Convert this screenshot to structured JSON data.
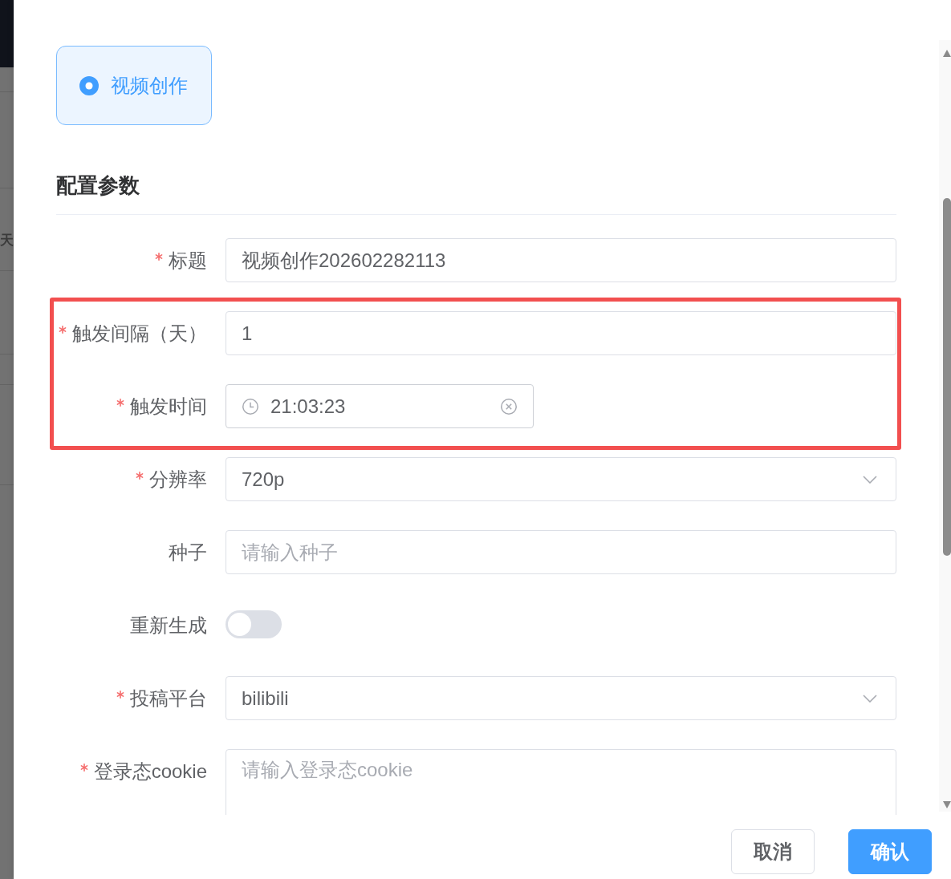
{
  "background_page": {
    "visible_text": "天"
  },
  "mode_card": {
    "label": "视频创作",
    "selected": true
  },
  "section": {
    "title": "配置参数"
  },
  "fields": [
    {
      "kind": "text",
      "label": "标题",
      "required": true,
      "value": "视频创作202602282113",
      "highlighted": false
    },
    {
      "kind": "text",
      "label": "触发间隔（天）",
      "required": true,
      "value": "1",
      "highlighted": true
    },
    {
      "kind": "time",
      "label": "触发时间",
      "required": true,
      "value": "21:03:23",
      "highlighted": true
    },
    {
      "kind": "select",
      "label": "分辨率",
      "required": true,
      "value": "720p",
      "highlighted": false
    },
    {
      "kind": "text",
      "label": "种子",
      "required": false,
      "placeholder": "请输入种子",
      "highlighted": false
    },
    {
      "kind": "switch",
      "label": "重新生成",
      "required": false,
      "on": false,
      "highlighted": false
    },
    {
      "kind": "select",
      "label": "投稿平台",
      "required": true,
      "value": "bilibili",
      "highlighted": false
    },
    {
      "kind": "textarea",
      "label": "登录态cookie",
      "required": true,
      "placeholder": "请输入登录态cookie",
      "highlighted": false
    }
  ],
  "footer": {
    "buttons": [
      {
        "kind": "cancel",
        "label": "取消"
      },
      {
        "kind": "confirm",
        "label": "确认"
      }
    ]
  }
}
